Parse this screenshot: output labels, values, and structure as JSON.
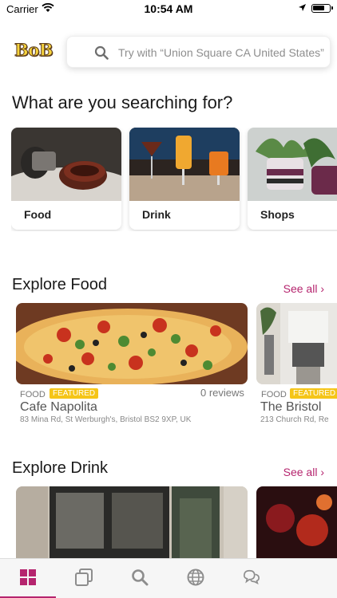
{
  "status_bar": {
    "carrier": "Carrier",
    "time": "10:54 AM"
  },
  "header": {
    "logo": "BoB",
    "search_placeholder": "Try with “Union Square CA United States”"
  },
  "question": "What are you searching for?",
  "categories": [
    {
      "label": "Food"
    },
    {
      "label": "Drink"
    },
    {
      "label": "Shops"
    }
  ],
  "explore_food": {
    "title": "Explore Food",
    "see_all": "See all",
    "places": [
      {
        "category": "FOOD",
        "badge": "FEATURED",
        "reviews": "0 reviews",
        "name": "Cafe Napolita",
        "address": "83 Mina Rd, St Werburgh's, Bristol BS2 9XP, UK"
      },
      {
        "category": "FOOD",
        "badge": "FEATURED",
        "name": "The Bristol",
        "address": "213 Church Rd, Re"
      }
    ]
  },
  "explore_drink": {
    "title": "Explore Drink",
    "see_all": "See all"
  },
  "tabs": [
    {
      "name": "tab-home",
      "icon": "grid-icon",
      "active": true
    },
    {
      "name": "tab-collections",
      "icon": "cards-icon",
      "active": false
    },
    {
      "name": "tab-search",
      "icon": "search-icon",
      "active": false
    },
    {
      "name": "tab-explore",
      "icon": "globe-icon",
      "active": false
    },
    {
      "name": "tab-messages",
      "icon": "chat-icon",
      "active": false
    }
  ],
  "colors": {
    "accent": "#b5246e",
    "badge": "#f5c518"
  }
}
